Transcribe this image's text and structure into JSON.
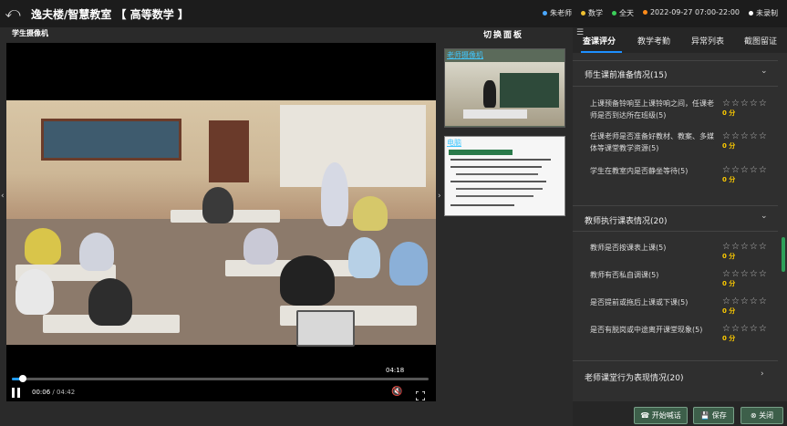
{
  "header": {
    "title": "逸夫楼/智慧教室 【 高等数学 】",
    "teacher": "朱老师",
    "subject": "数学",
    "duration": "全天",
    "datetime": "2022-09-27 07:00-22:00",
    "record_status": "未录制",
    "colors": {
      "teacher": "#4aa8ff",
      "subject": "#f0c030",
      "duration": "#3ccf5a",
      "datetime": "#ff8c1a",
      "record": "#ffffff"
    }
  },
  "player": {
    "camera_label": "学生摄像机",
    "hover_time": "04:18",
    "current_time": "00:06",
    "separator": " / ",
    "total_time": "04:42",
    "progress": 0.021
  },
  "switch_panel": {
    "title": "切换面板",
    "thumbs": [
      {
        "label": "老师摄像机"
      },
      {
        "label": "电脑"
      }
    ]
  },
  "tabs": [
    "查课评分",
    "教学考勤",
    "异常列表",
    "截图留证"
  ],
  "sections": [
    {
      "title": "师生课前准备情况(15)",
      "items": [
        {
          "text": "上课预备铃响至上课铃响之间，任课老师是否到达所在班级(5)",
          "score": "0 分"
        },
        {
          "text": "任课老师是否准备好教材、教案、多媒体等课堂教学资源(5)",
          "score": "0 分"
        },
        {
          "text": "学生在教室内是否静坐等待(5)",
          "score": "0 分"
        }
      ]
    },
    {
      "title": "教师执行课表情况(20)",
      "items": [
        {
          "text": "教师是否按课表上课(5)",
          "score": "0 分"
        },
        {
          "text": "教师有否私自调课(5)",
          "score": "0 分"
        },
        {
          "text": "是否提前或拖后上课或下课(5)",
          "score": "0 分"
        },
        {
          "text": "是否有脱岗或中途离开课堂现象(5)",
          "score": "0 分"
        }
      ]
    },
    {
      "title": "老师课堂行为表现情况(20)",
      "items": []
    }
  ],
  "actions": {
    "start_call": "开始喊话",
    "save": "保存",
    "close": "关闭"
  }
}
